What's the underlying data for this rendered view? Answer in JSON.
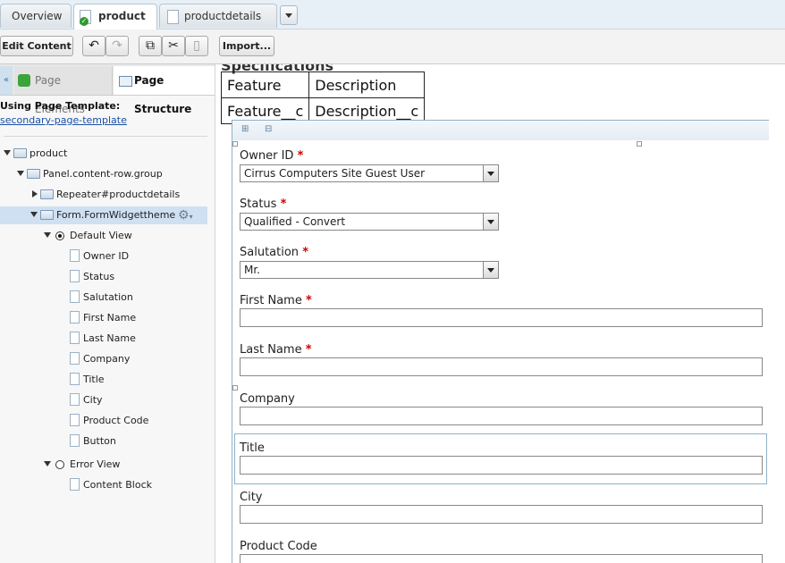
{
  "tabs": [
    {
      "label": "Overview"
    },
    {
      "label": "product"
    },
    {
      "label": "productdetails"
    }
  ],
  "toolbar": {
    "edit_label": "Edit Content",
    "import_label": "Import..."
  },
  "left_panel": {
    "tab_elements": "Page Elements",
    "tab_structure": "Page Structure",
    "template_label": "Using Page Template:",
    "template_link": "secondary-page-template",
    "tree": {
      "product": "product",
      "panel": "Panel.content-row.group",
      "repeater": "Repeater#productdetails",
      "form": "Form.FormWidgettheme",
      "default_view": "Default View",
      "fields": [
        "Owner ID",
        "Status",
        "Salutation",
        "First Name",
        "Last Name",
        "Company",
        "Title",
        "City",
        "Product Code",
        "Button"
      ],
      "error_view": "Error View",
      "content_block": "Content Block"
    }
  },
  "main": {
    "spec_heading": "Specifications",
    "spec_table": {
      "headers": [
        "Feature",
        "Description"
      ],
      "row": [
        "Feature__c",
        "Description__c"
      ]
    },
    "form": {
      "owner_label": "Owner ID",
      "owner_value": "Cirrus Computers Site Guest User",
      "status_label": "Status",
      "status_value": "Qualified - Convert",
      "salutation_label": "Salutation",
      "salutation_value": "Mr.",
      "first_name_label": "First Name",
      "last_name_label": "Last Name",
      "company_label": "Company",
      "title_label": "Title",
      "city_label": "City",
      "product_code_label": "Product Code",
      "required_mark": "*"
    }
  }
}
